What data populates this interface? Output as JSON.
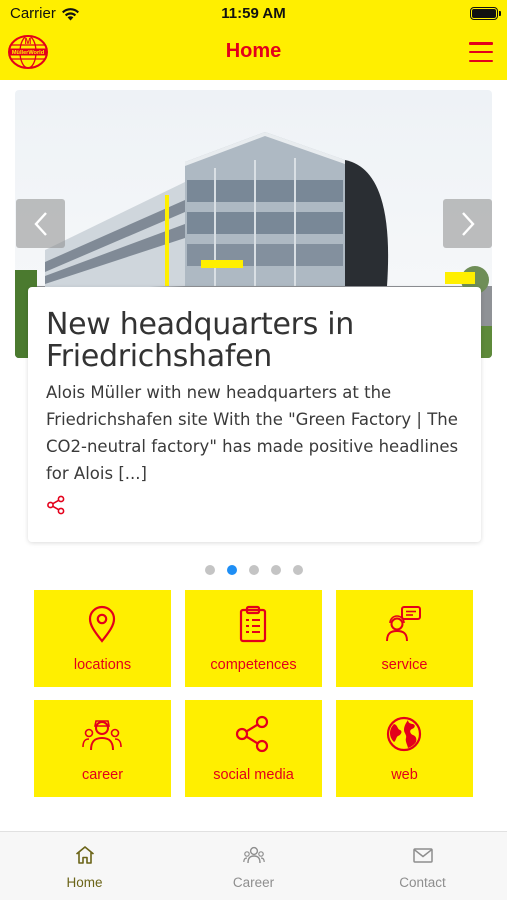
{
  "status_bar": {
    "carrier": "Carrier",
    "time": "11:59 AM"
  },
  "header": {
    "title": "Home",
    "logo_text": "MüllerWorld"
  },
  "news_slider": {
    "slide_count": 5,
    "active_index": 1,
    "headline": "New headquarters in Friedrichshafen",
    "teaser": "Alois Müller with new headquarters at the Friedrichshafen site With the \"Green Factory | The CO2-neutral factory\" has made positive headlines for Alois [...]"
  },
  "tiles": [
    {
      "label": "locations",
      "icon": "map-pin-icon"
    },
    {
      "label": "competences",
      "icon": "clipboard-icon"
    },
    {
      "label": "service",
      "icon": "support-agent-icon"
    },
    {
      "label": "career",
      "icon": "people-group-icon"
    },
    {
      "label": "social media",
      "icon": "share-network-icon"
    },
    {
      "label": "web",
      "icon": "globe-icon"
    }
  ],
  "tabbar": [
    {
      "label": "Home",
      "icon": "home-icon",
      "active": true
    },
    {
      "label": "Career",
      "icon": "people-icon",
      "active": false
    },
    {
      "label": "Contact",
      "icon": "envelope-icon",
      "active": false
    }
  ],
  "colors": {
    "brand_yellow": "#ffef00",
    "brand_red": "#e3001b",
    "active_dot": "#1e8ef5"
  }
}
